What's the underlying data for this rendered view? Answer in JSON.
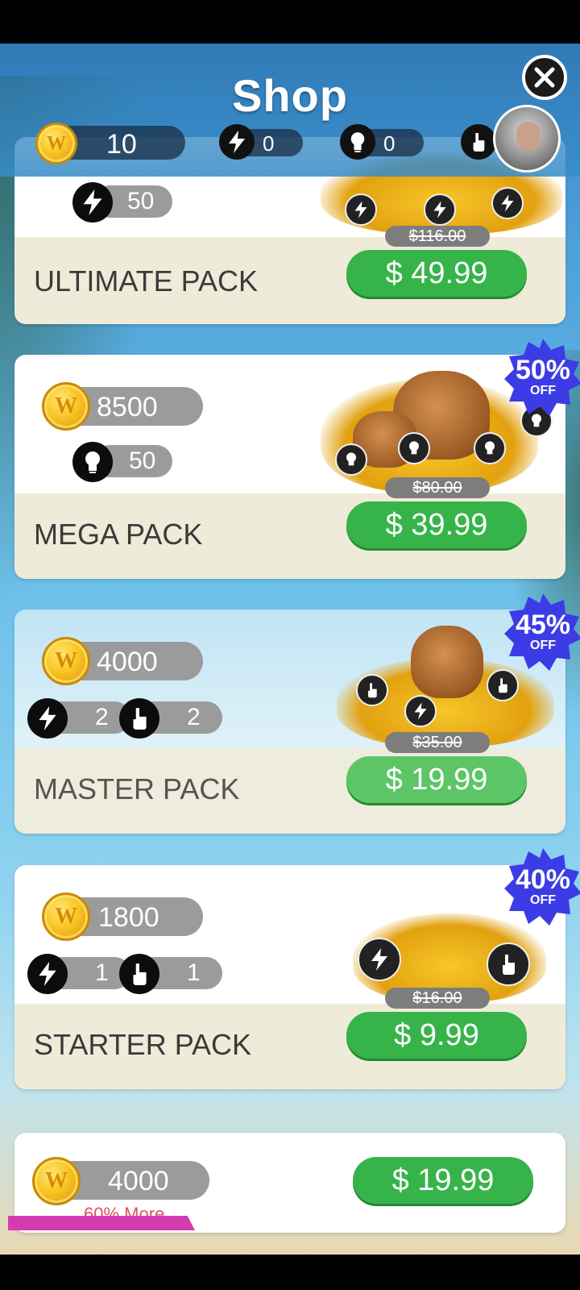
{
  "header": {
    "title": "Shop",
    "coins": "10",
    "boosts": "0",
    "hints": "0"
  },
  "packs": [
    {
      "name": "ULTIMATE PACK",
      "hints_or_boost": "50",
      "old_price": "$116.00",
      "price": "$ 49.99"
    },
    {
      "name": "MEGA PACK",
      "coins": "8500",
      "hints": "50",
      "old_price": "$80.00",
      "price": "$ 39.99",
      "discount_pct": "50%",
      "discount_off": "OFF"
    },
    {
      "name": "MASTER PACK",
      "coins": "4000",
      "boosts": "2",
      "pointers": "2",
      "old_price": "$35.00",
      "price": "$ 19.99",
      "discount_pct": "45%",
      "discount_off": "OFF"
    },
    {
      "name": "STARTER PACK",
      "coins": "1800",
      "boosts": "1",
      "pointers": "1",
      "old_price": "$16.00",
      "price": "$ 9.99",
      "discount_pct": "40%",
      "discount_off": "OFF"
    }
  ],
  "coin_offer": {
    "coins": "4000",
    "bonus": "60% More",
    "price": "$ 19.99"
  },
  "colors": {
    "buy_green": "#36b44a",
    "badge_blue": "#3c3ce6",
    "bonus_red": "#e0525a"
  },
  "icons": [
    "close-icon",
    "coin-icon",
    "bolt-icon",
    "bulb-icon",
    "pointer-icon"
  ]
}
